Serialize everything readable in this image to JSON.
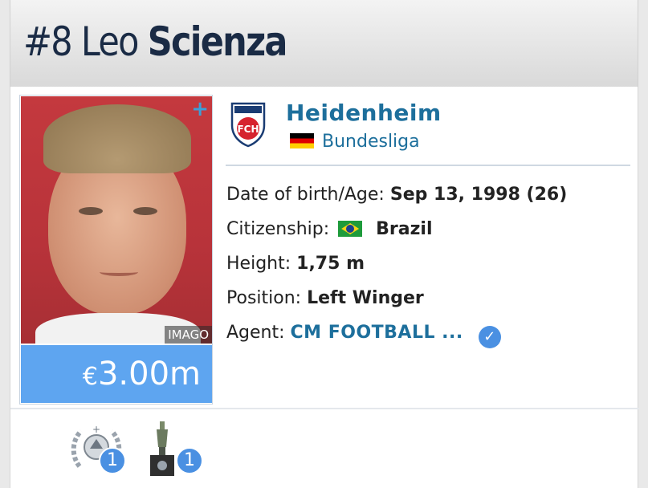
{
  "header": {
    "number": "#8",
    "first_name": "Leo",
    "last_name": "Scienza"
  },
  "photo": {
    "credit": "IMAGO"
  },
  "market_value": {
    "currency": "€",
    "amount": "3.00m"
  },
  "club": {
    "name": "Heidenheim",
    "logo_text": "FCH",
    "league": "Bundesliga",
    "league_flag": "germany-flag"
  },
  "info": {
    "dob_label": "Date of birth/Age:",
    "dob_value": "Sep 13, 1998 (26)",
    "citizenship_label": "Citizenship:",
    "citizenship_value": "Brazil",
    "citizenship_flag": "brazil-flag",
    "height_label": "Height:",
    "height_value": "1,75 m",
    "position_label": "Position:",
    "position_value": "Left Winger",
    "agent_label": "Agent:",
    "agent_value": "CM FOOTBALL ..."
  },
  "trophies": [
    {
      "icon": "laurel-wreath-icon",
      "count": "1"
    },
    {
      "icon": "cup-trophy-icon",
      "count": "1"
    }
  ],
  "colors": {
    "accent": "#1d6f9c",
    "market_value_bg": "#5ea5f0",
    "badge": "#4a90e2",
    "title": "#1a2b45"
  }
}
